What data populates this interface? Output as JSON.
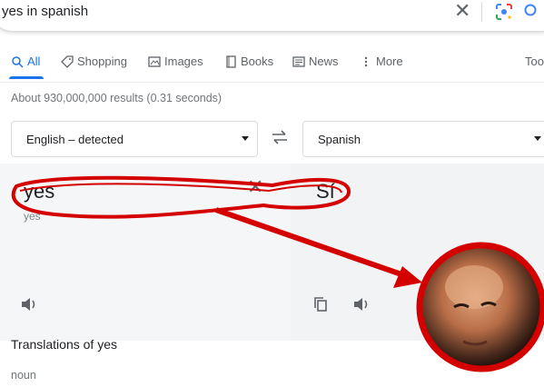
{
  "search": {
    "query": "yes in spanish",
    "clear_icon": "close-icon",
    "lens_icon": "google-lens-icon",
    "search_icon": "search-icon"
  },
  "tabs": [
    {
      "label": "All",
      "icon": "search-icon",
      "active": true
    },
    {
      "label": "Shopping",
      "icon": "tag-icon"
    },
    {
      "label": "Images",
      "icon": "image-icon"
    },
    {
      "label": "Books",
      "icon": "book-icon"
    },
    {
      "label": "News",
      "icon": "newspaper-icon"
    },
    {
      "label": "More",
      "icon": "kebab-icon"
    },
    {
      "label": "Too"
    }
  ],
  "stats": "About 930,000,000 results (0.31 seconds)",
  "translator": {
    "source_lang": "English – detected",
    "target_lang": "Spanish",
    "source_text": "yes",
    "transliteration": "yes",
    "target_text": "Sí"
  },
  "details": {
    "heading": "Translations of yes",
    "part_of_speech": "noun"
  },
  "colors": {
    "accent": "#1a73e8",
    "annotation_red": "#d40000"
  }
}
